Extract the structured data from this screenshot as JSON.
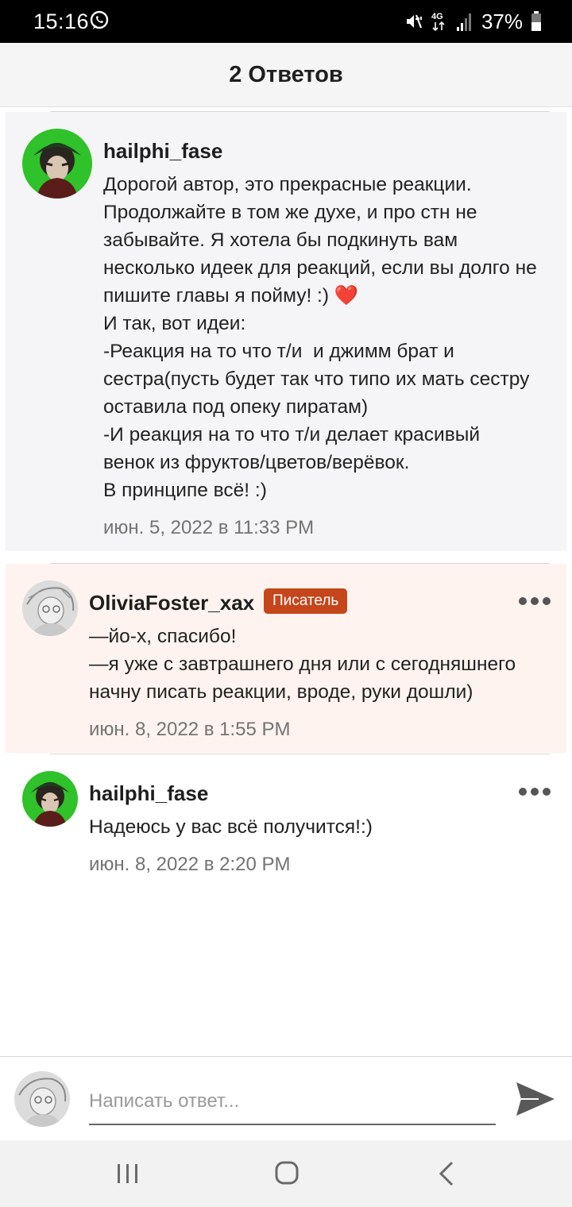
{
  "status_bar": {
    "time": "15:16",
    "network": "4G",
    "battery": "37%",
    "icons": [
      "whatsapp-icon",
      "mute-icon",
      "signal-icon",
      "battery-icon"
    ]
  },
  "header": {
    "title": "2 Ответов"
  },
  "comments": [
    {
      "username": "hailphi_fase",
      "body": "Дорогой автор, это прекрасные реакции.\nПродолжайте в том же духе, и про стн не\nзабывайте. Я хотела бы подкинуть вам\nнесколько идеек для реакций, если вы долго не\nпишите главы я пойму! :) ❤️\nИ так, вот идеи:\n-Реакция на то что т/и  и джимм брат и\nсестра(пусть будет так что типо их мать сестру\nоставила под опеку пиратам)\n-И реакция на то что т/и делает красивый\nвенок из фруктов/цветов/верёвок.\nВ принципе всё! :)",
      "timestamp": "июн. 5, 2022 в 11:33 PM"
    },
    {
      "username": "OliviaFoster_xax",
      "badge": "Писатель",
      "body": "—йо-х, спасибо!\n—я уже с завтрашнего дня или с сегодняшнего\nначну писать реакции, вроде, руки дошли)",
      "timestamp": "июн. 8, 2022 в 1:55 PM"
    },
    {
      "username": "hailphi_fase",
      "body": "Надеюсь у вас всё получится!:)",
      "timestamp": "июн. 8, 2022 в 2:20 PM"
    }
  ],
  "reply": {
    "placeholder": "Написать ответ..."
  },
  "colors": {
    "status_bar_bg": "#000000",
    "header_bg": "#f5f5f5",
    "comment_bg": "#f5f4f6",
    "author_reply_bg": "#fef3ee",
    "writer_badge": "#c4461a",
    "timestamp": "#737373"
  }
}
